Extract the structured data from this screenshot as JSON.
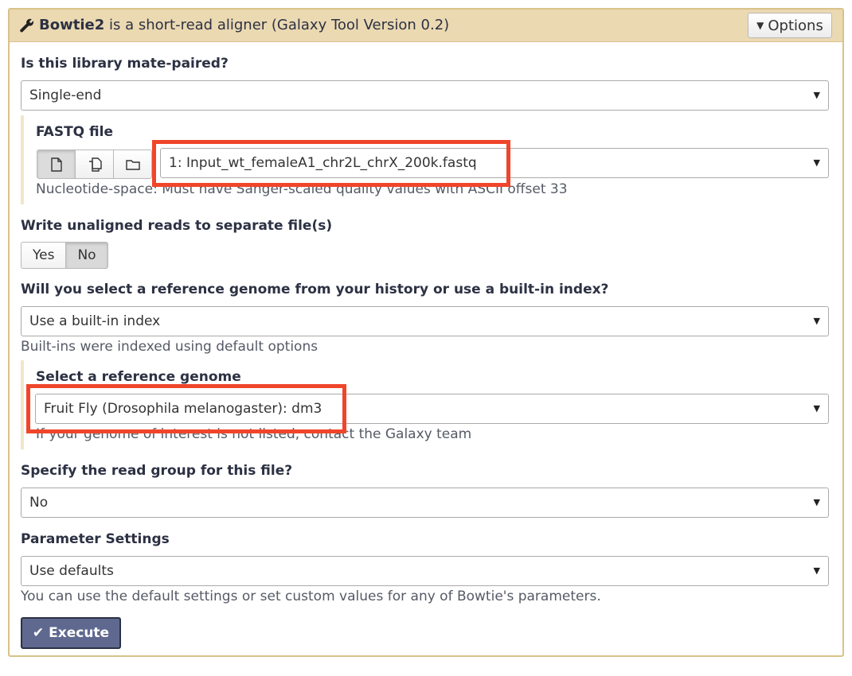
{
  "header": {
    "tool_name": "Bowtie2",
    "description": "is a short-read aligner (Galaxy Tool Version 0.2)",
    "options_label": "Options"
  },
  "mate_paired": {
    "label": "Is this library mate-paired?",
    "value": "Single-end"
  },
  "fastq": {
    "label": "FASTQ file",
    "value": "1: Input_wt_femaleA1_chr2L_chrX_200k.fastq",
    "help": "Nucleotide-space: Must have Sanger-scaled quality values with ASCII offset 33",
    "buttons": [
      "single-dataset-icon",
      "multiple-datasets-icon",
      "dataset-collection-icon"
    ]
  },
  "unaligned": {
    "label": "Write unaligned reads to separate file(s)",
    "options": [
      "Yes",
      "No"
    ],
    "selected": "No"
  },
  "reference_source": {
    "label": "Will you select a reference genome from your history or use a built-in index?",
    "value": "Use a built-in index",
    "help": "Built-ins were indexed using default options"
  },
  "reference_genome": {
    "label": "Select a reference genome",
    "value": "Fruit Fly (Drosophila melanogaster): dm3",
    "help": "If your genome of interest is not listed, contact the Galaxy team"
  },
  "read_group": {
    "label": "Specify the read group for this file?",
    "value": "No"
  },
  "parameter_settings": {
    "label": "Parameter Settings",
    "value": "Use defaults",
    "help": "You can use the default settings or set custom values for any of Bowtie's parameters."
  },
  "execute_label": "Execute",
  "colors": {
    "header_bg": "#ebd9b2",
    "border": "#d9c28a",
    "highlight": "#f0452a",
    "execute_bg": "#5f6990"
  }
}
